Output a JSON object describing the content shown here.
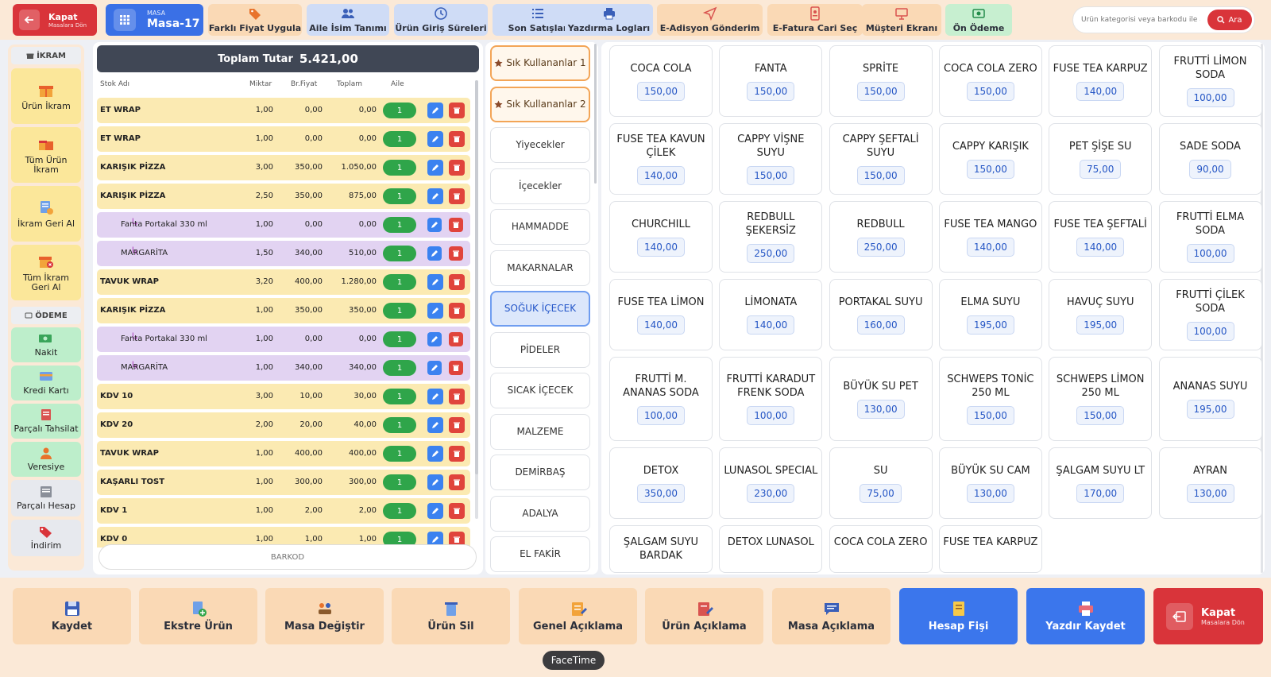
{
  "topbar": {
    "close": {
      "label": "Kapat",
      "sub": "Masalara Dön"
    },
    "table": {
      "caption": "MASA",
      "value": "Masa-17"
    },
    "buttons": [
      {
        "label": "Farklı Fiyat Uygula",
        "icon": "tag-icon"
      },
      {
        "label": "Aile İsim Tanımı",
        "icon": "users-icon"
      },
      {
        "label": "Ürün Giriş Süreleri",
        "icon": "clock-icon"
      },
      {
        "label": "Son Satışlar",
        "icon": "list-icon"
      },
      {
        "label": "Yazdırma Logları",
        "icon": "printer-icon"
      },
      {
        "label": "E-Adisyon Gönderim",
        "icon": "send-icon"
      },
      {
        "label": "E-Fatura Cari Seç",
        "icon": "invoice-icon"
      },
      {
        "label": "Müşteri Ekranı",
        "icon": "monitor-icon"
      },
      {
        "label": "Ön Ödeme",
        "icon": "money-icon"
      }
    ],
    "search": {
      "placeholder": "Ürün kategorisi veya barkodu ile arama",
      "button": "Ara"
    }
  },
  "sidebar": {
    "ikram_title": "İKRAM",
    "ikram_items": [
      "Ürün İkram",
      "Tüm Ürün İkram",
      "İkram Geri Al",
      "Tüm İkram Geri Al"
    ],
    "odeme_title": "ÖDEME",
    "odeme_items": [
      "Nakit",
      "Kredi Kartı",
      "Parçalı Tahsilat",
      "Veresiye",
      "Parçalı Hesap",
      "İndirim"
    ]
  },
  "order": {
    "total_label": "Toplam Tutar",
    "total_value": "5.421,00",
    "headers": {
      "name": "Stok Adı",
      "qty": "Miktar",
      "unit": "Br.Fiyat",
      "total": "Toplam",
      "family": "Aile"
    },
    "rows": [
      {
        "name": "ET WRAP",
        "qty": "1,00",
        "unit": "0,00",
        "total": "0,00",
        "family": "1",
        "sub": false
      },
      {
        "name": "ET WRAP",
        "qty": "1,00",
        "unit": "0,00",
        "total": "0,00",
        "family": "1",
        "sub": false
      },
      {
        "name": "KARIŞIK PİZZA",
        "qty": "3,00",
        "unit": "350,00",
        "total": "1.050,00",
        "family": "1",
        "sub": false
      },
      {
        "name": "KARIŞIK PİZZA",
        "qty": "2,50",
        "unit": "350,00",
        "total": "875,00",
        "family": "1",
        "sub": false
      },
      {
        "name": "Fanta Portakal 330 ml",
        "qty": "1,00",
        "unit": "0,00",
        "total": "0,00",
        "family": "1",
        "sub": true
      },
      {
        "name": "MARGARİTA",
        "qty": "1,50",
        "unit": "340,00",
        "total": "510,00",
        "family": "1",
        "sub": true
      },
      {
        "name": "TAVUK WRAP",
        "qty": "3,20",
        "unit": "400,00",
        "total": "1.280,00",
        "family": "1",
        "sub": false
      },
      {
        "name": "KARIŞIK PİZZA",
        "qty": "1,00",
        "unit": "350,00",
        "total": "350,00",
        "family": "1",
        "sub": false
      },
      {
        "name": "Fanta Portakal 330 ml",
        "qty": "1,00",
        "unit": "0,00",
        "total": "0,00",
        "family": "1",
        "sub": true
      },
      {
        "name": "MARGARİTA",
        "qty": "1,00",
        "unit": "340,00",
        "total": "340,00",
        "family": "1",
        "sub": true
      },
      {
        "name": "KDV 10",
        "qty": "3,00",
        "unit": "10,00",
        "total": "30,00",
        "family": "1",
        "sub": false
      },
      {
        "name": "KDV 20",
        "qty": "2,00",
        "unit": "20,00",
        "total": "40,00",
        "family": "1",
        "sub": false
      },
      {
        "name": "TAVUK WRAP",
        "qty": "1,00",
        "unit": "400,00",
        "total": "400,00",
        "family": "1",
        "sub": false
      },
      {
        "name": "KAŞARLI TOST",
        "qty": "1,00",
        "unit": "300,00",
        "total": "300,00",
        "family": "1",
        "sub": false
      },
      {
        "name": "KDV 1",
        "qty": "1,00",
        "unit": "2,00",
        "total": "2,00",
        "family": "1",
        "sub": false
      },
      {
        "name": "KDV 0",
        "qty": "1,00",
        "unit": "1,00",
        "total": "1,00",
        "family": "1",
        "sub": false
      }
    ],
    "barcode_placeholder": "BARKOD"
  },
  "categories": [
    {
      "label": "Sık Kullananlar 1",
      "fav": true
    },
    {
      "label": "Sık Kullananlar 2",
      "fav": true
    },
    {
      "label": "Yiyecekler"
    },
    {
      "label": "İçecekler"
    },
    {
      "label": "HAMMADDE"
    },
    {
      "label": "MAKARNALAR"
    },
    {
      "label": "SOĞUK İÇECEK",
      "active": true
    },
    {
      "label": "PİDELER"
    },
    {
      "label": "SICAK İÇECEK"
    },
    {
      "label": "MALZEME"
    },
    {
      "label": "DEMİRBAŞ"
    },
    {
      "label": "ADALYA"
    },
    {
      "label": "EL FAKİR"
    }
  ],
  "products": [
    {
      "name": "COCA COLA",
      "price": "150,00"
    },
    {
      "name": "FANTA",
      "price": "150,00"
    },
    {
      "name": "SPRİTE",
      "price": "150,00"
    },
    {
      "name": "COCA COLA ZERO",
      "price": "150,00"
    },
    {
      "name": "FUSE TEA KARPUZ",
      "price": "140,00"
    },
    {
      "name": "FRUTTİ LİMON SODA",
      "price": "100,00"
    },
    {
      "name": "FUSE TEA KAVUN ÇİLEK",
      "price": "140,00"
    },
    {
      "name": "CAPPY VİŞNE SUYU",
      "price": "150,00"
    },
    {
      "name": "CAPPY ŞEFTALİ SUYU",
      "price": "150,00"
    },
    {
      "name": "CAPPY KARIŞIK",
      "price": "150,00"
    },
    {
      "name": "PET ŞİŞE SU",
      "price": "75,00"
    },
    {
      "name": "SADE SODA",
      "price": "90,00"
    },
    {
      "name": "CHURCHILL",
      "price": "140,00"
    },
    {
      "name": "REDBULL ŞEKERSİZ",
      "price": "250,00"
    },
    {
      "name": "REDBULL",
      "price": "250,00"
    },
    {
      "name": "FUSE TEA MANGO",
      "price": "140,00"
    },
    {
      "name": "FUSE TEA ŞEFTALİ",
      "price": "140,00"
    },
    {
      "name": "FRUTTİ ELMA SODA",
      "price": "100,00"
    },
    {
      "name": "FUSE TEA LİMON",
      "price": "140,00"
    },
    {
      "name": "LİMONATA",
      "price": "140,00"
    },
    {
      "name": "PORTAKAL SUYU",
      "price": "160,00"
    },
    {
      "name": "ELMA SUYU",
      "price": "195,00"
    },
    {
      "name": "HAVUÇ SUYU",
      "price": "195,00"
    },
    {
      "name": "FRUTTİ ÇİLEK SODA",
      "price": "100,00"
    },
    {
      "name": "FRUTTİ M. ANANAS SODA",
      "price": "100,00"
    },
    {
      "name": "FRUTTİ KARADUT FRENK SODA",
      "price": "100,00"
    },
    {
      "name": "BÜYÜK SU PET",
      "price": "130,00"
    },
    {
      "name": "SCHWEPS TONİC 250 ML",
      "price": "150,00"
    },
    {
      "name": "SCHWEPS LİMON 250 ML",
      "price": "150,00"
    },
    {
      "name": "ANANAS SUYU",
      "price": "195,00"
    },
    {
      "name": "DETOX",
      "price": "350,00"
    },
    {
      "name": "LUNASOL SPECIAL",
      "price": "230,00"
    },
    {
      "name": "SU",
      "price": "75,00"
    },
    {
      "name": "BÜYÜK SU CAM",
      "price": "130,00"
    },
    {
      "name": "ŞALGAM SUYU LT",
      "price": "170,00"
    },
    {
      "name": "AYRAN",
      "price": "130,00"
    },
    {
      "name": "ŞALGAM SUYU BARDAK",
      "price": ""
    },
    {
      "name": "DETOX LUNASOL",
      "price": ""
    },
    {
      "name": "COCA COLA ZERO",
      "price": ""
    },
    {
      "name": "FUSE TEA KARPUZ",
      "price": ""
    }
  ],
  "bottombar": {
    "buttons": [
      {
        "label": "Kaydet",
        "icon": "floppy-icon"
      },
      {
        "label": "Ekstre Ürün",
        "icon": "doc-plus-icon"
      },
      {
        "label": "Masa Değiştir",
        "icon": "people-swap-icon"
      },
      {
        "label": "Ürün Sil",
        "icon": "trash-icon"
      },
      {
        "label": "Genel Açıklama",
        "icon": "note-icon"
      },
      {
        "label": "Ürün Açıklama",
        "icon": "note-edit-icon"
      },
      {
        "label": "Masa Açıklama",
        "icon": "chat-icon"
      },
      {
        "label": "Hesap Fişi",
        "icon": "receipt-icon"
      },
      {
        "label": "Yazdır Kaydet",
        "icon": "print-save-icon"
      }
    ],
    "close": {
      "label": "Kapat",
      "sub": "Masalara Dön"
    }
  },
  "dock_tooltip": "FaceTime"
}
